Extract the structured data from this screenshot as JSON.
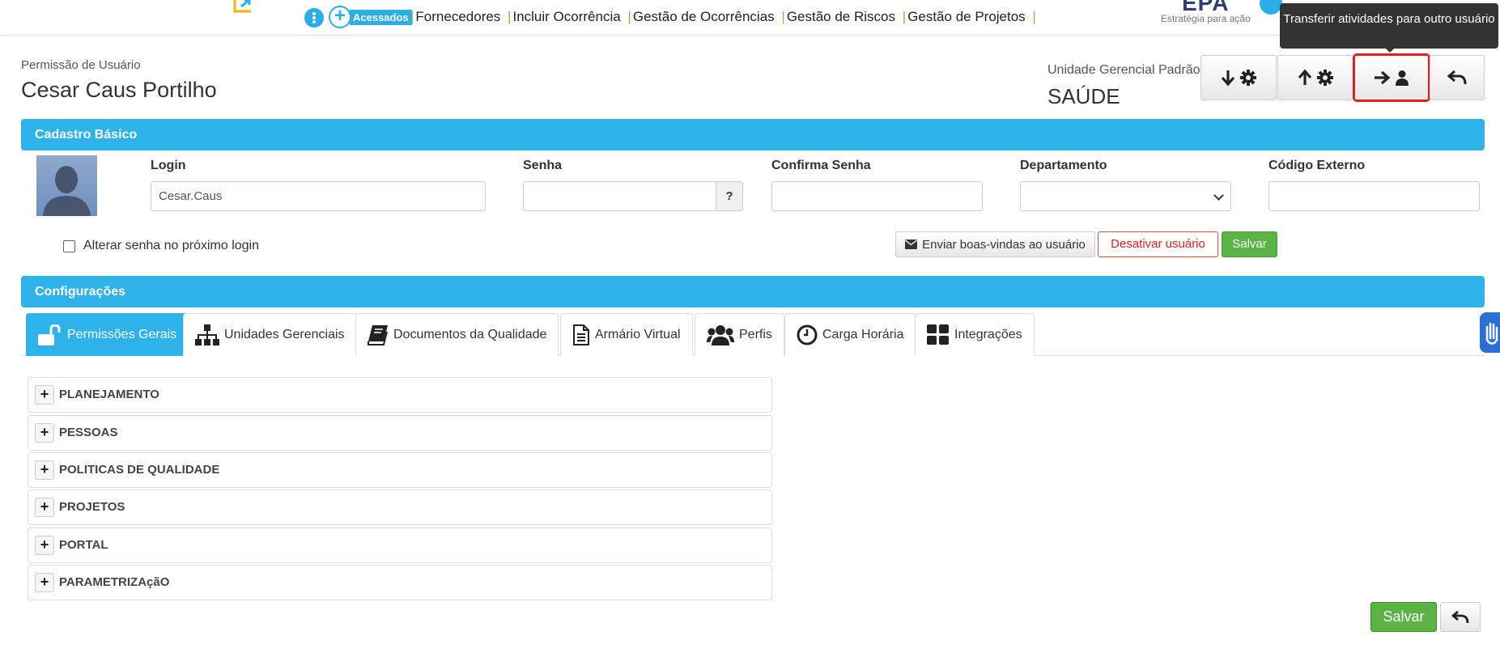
{
  "nav": {
    "acessados_label": "Acessados",
    "links": [
      "Fornecedores",
      "Incluir Ocorrência",
      "Gestão de Ocorrências",
      "Gestão de Riscos",
      "Gestão de Projetos"
    ],
    "brand_name": "EPA",
    "brand_tagline": "Estratégia para ação"
  },
  "tooltip": {
    "text": "Transferir atividades para outro usuário"
  },
  "header": {
    "subtitle": "Permissão de Usuário",
    "title": "Cesar Caus Portilho",
    "unidade_label": "Unidade Gerencial Padrão",
    "unidade_value": "SAÚDE",
    "buttons": [
      {
        "name": "download-settings-button",
        "icon": "arrow-down-gear-icon"
      },
      {
        "name": "upload-settings-button",
        "icon": "arrow-up-gear-icon"
      },
      {
        "name": "transfer-activities-button",
        "icon": "arrow-right-user-icon"
      },
      {
        "name": "back-button",
        "icon": "reply-icon"
      }
    ]
  },
  "cadastro": {
    "section_title": "Cadastro Básico",
    "login_label": "Login",
    "login_value": "Cesar.Caus",
    "senha_label": "Senha",
    "senha_help": "?",
    "confirma_label": "Confirma Senha",
    "departamento_label": "Departamento",
    "codigo_label": "Código Externo",
    "alterar_senha_label": "Alterar senha no próximo login",
    "welcome_button": "Enviar boas-vindas ao usuário",
    "deactivate_button": "Desativar usuário",
    "save_button": "Salvar"
  },
  "config": {
    "section_title": "Configurações",
    "tabs": [
      {
        "label": "Permissões Gerais",
        "icon": "unlock-icon"
      },
      {
        "label": "Unidades Gerenciais",
        "icon": "sitemap-icon"
      },
      {
        "label": "Documentos da Qualidade",
        "icon": "book-icon"
      },
      {
        "label": "Armário Virtual",
        "icon": "document-icon"
      },
      {
        "label": "Perfis",
        "icon": "users-icon"
      },
      {
        "label": "Carga Horária",
        "icon": "clock-icon"
      },
      {
        "label": "Integrações",
        "icon": "grid-icon"
      }
    ],
    "sections": [
      "PLANEJAMENTO",
      "PESSOAS",
      "POLITICAS DE QUALIDADE",
      "PROJETOS",
      "PORTAL",
      "PARAMETRIZAçãO"
    ]
  },
  "footer": {
    "save_button": "Salvar"
  },
  "colors": {
    "accent": "#2eb2ea",
    "save_green": "#5cb345",
    "danger": "#d9231f",
    "highlight": "#e02020"
  }
}
